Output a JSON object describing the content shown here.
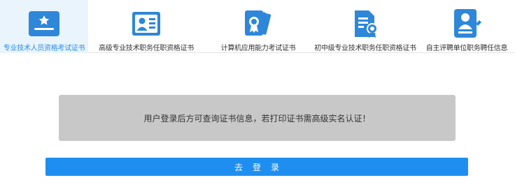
{
  "tabs": [
    {
      "label": "专业技术人员资格考试证书",
      "icon": "certificate-star-icon",
      "active": true
    },
    {
      "label": "高级专业技术职务任职资格证书",
      "icon": "id-card-icon",
      "active": false
    },
    {
      "label": "计算机应用能力考试证书",
      "icon": "certificate-stack-icon",
      "active": false
    },
    {
      "label": "初中级专业技术职务任职资格证书",
      "icon": "document-badge-icon",
      "active": false
    },
    {
      "label": "自主评聘单位职务聘任信息",
      "icon": "user-document-icon",
      "active": false
    }
  ],
  "notice": {
    "text": "用户登录后方可查询证书信息，若打印证书需高级实名认证！"
  },
  "login_button": {
    "label": "去登录"
  },
  "colors": {
    "primary": "#1e8ff0",
    "active_tab_bg": "#e9f4fd",
    "notice_bg": "#c8c8c8"
  }
}
